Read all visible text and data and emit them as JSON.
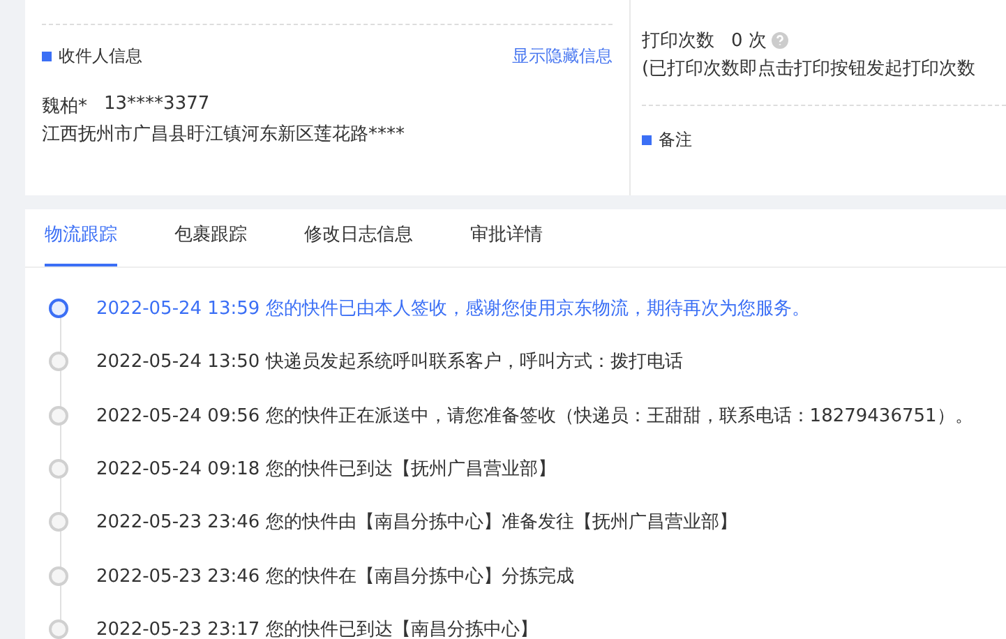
{
  "recipient": {
    "title": "收件人信息",
    "toggle_link": "显示隐藏信息",
    "name": "魏柏*",
    "phone": "13****3377",
    "address": "江西抚州市广昌县盱江镇河东新区莲花路****"
  },
  "print": {
    "label": "打印次数",
    "count": "0 次",
    "note": "(已打印次数即点击打印按钮发起打印次数"
  },
  "remarks": {
    "title": "备注"
  },
  "tabs": [
    {
      "label": "物流跟踪",
      "selected": true
    },
    {
      "label": "包裹跟踪",
      "selected": false
    },
    {
      "label": "修改日志信息",
      "selected": false
    },
    {
      "label": "审批详情",
      "selected": false
    }
  ],
  "timeline": [
    {
      "time": "2022-05-24 13:59",
      "text": "您的快件已由本人签收，感谢您使用京东物流，期待再次为您服务。",
      "selected": true
    },
    {
      "time": "2022-05-24 13:50",
      "text": "快递员发起系统呼叫联系客户，呼叫方式：拨打电话",
      "selected": false
    },
    {
      "time": "2022-05-24 09:56",
      "text": "您的快件正在派送中，请您准备签收（快递员：王甜甜，联系电话：18279436751）。",
      "selected": false
    },
    {
      "time": "2022-05-24 09:18",
      "text": "您的快件已到达【抚州广昌营业部】",
      "selected": false
    },
    {
      "time": "2022-05-23 23:46",
      "text": "您的快件由【南昌分拣中心】准备发往【抚州广昌营业部】",
      "selected": false
    },
    {
      "time": "2022-05-23 23:46",
      "text": "您的快件在【南昌分拣中心】分拣完成",
      "selected": false
    },
    {
      "time": "2022-05-23 23:17",
      "text": "您的快件已到达【南昌分拣中心】",
      "selected": false
    }
  ]
}
